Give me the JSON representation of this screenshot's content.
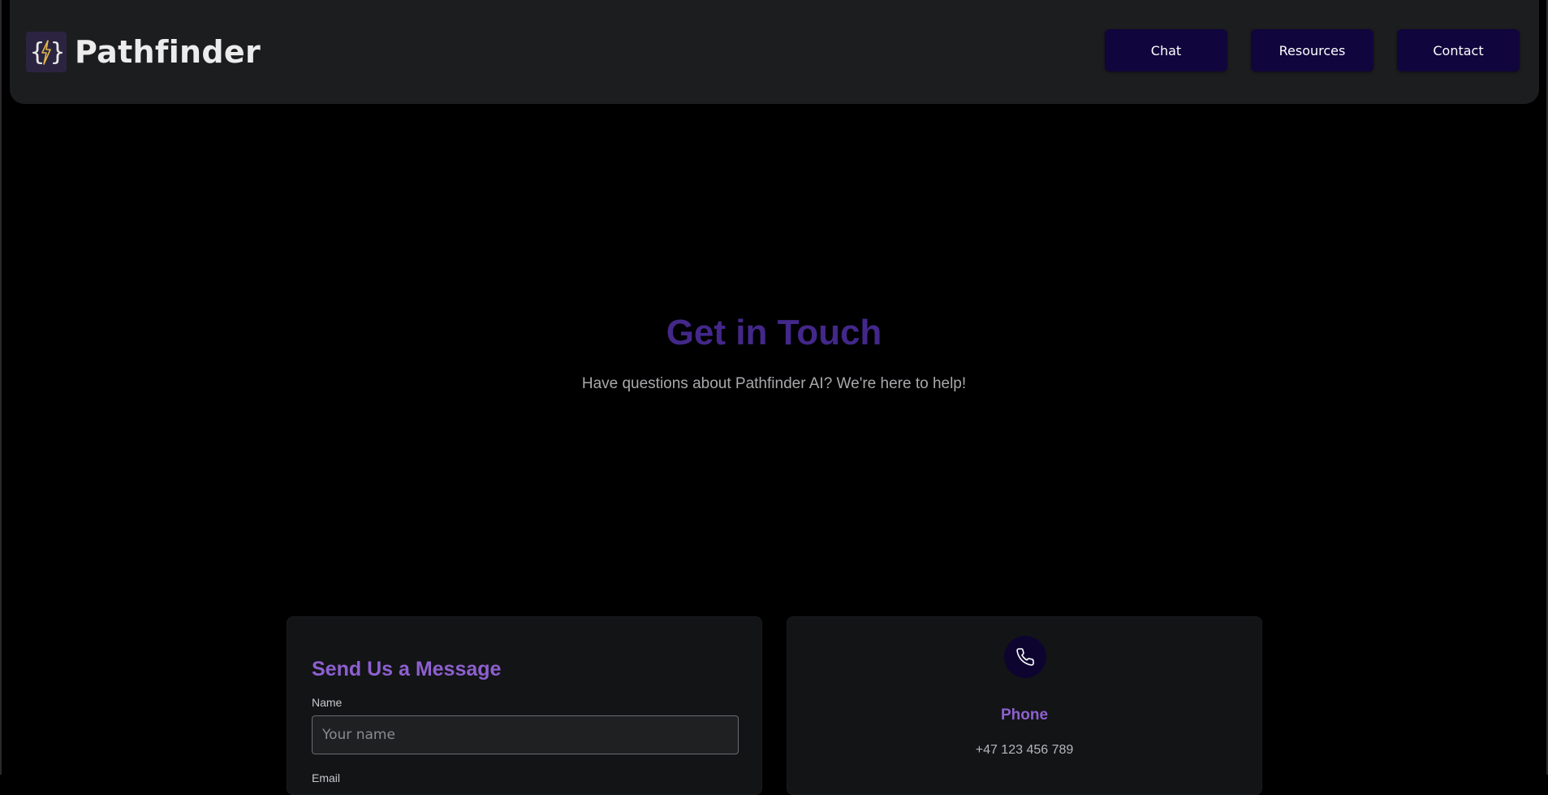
{
  "header": {
    "brand_name": "Pathfinder",
    "logo_icon": "braces-lightning-icon",
    "nav": [
      {
        "label": "Chat"
      },
      {
        "label": "Resources"
      },
      {
        "label": "Contact"
      }
    ]
  },
  "hero": {
    "title": "Get in Touch",
    "subtitle": "Have questions about Pathfinder AI? We're here to help!"
  },
  "form": {
    "title": "Send Us a Message",
    "name_label": "Name",
    "name_placeholder": "Your name",
    "name_value": "",
    "email_label": "Email"
  },
  "contact_info": {
    "phone": {
      "icon": "phone-icon",
      "title": "Phone",
      "value": "+47 123 456 789"
    }
  },
  "colors": {
    "background": "#000000",
    "navbar": "#1c1d1f",
    "nav_button": "#11053d",
    "hero_title": "#43288a",
    "accent": "#8d60cf",
    "card": "#131416"
  }
}
